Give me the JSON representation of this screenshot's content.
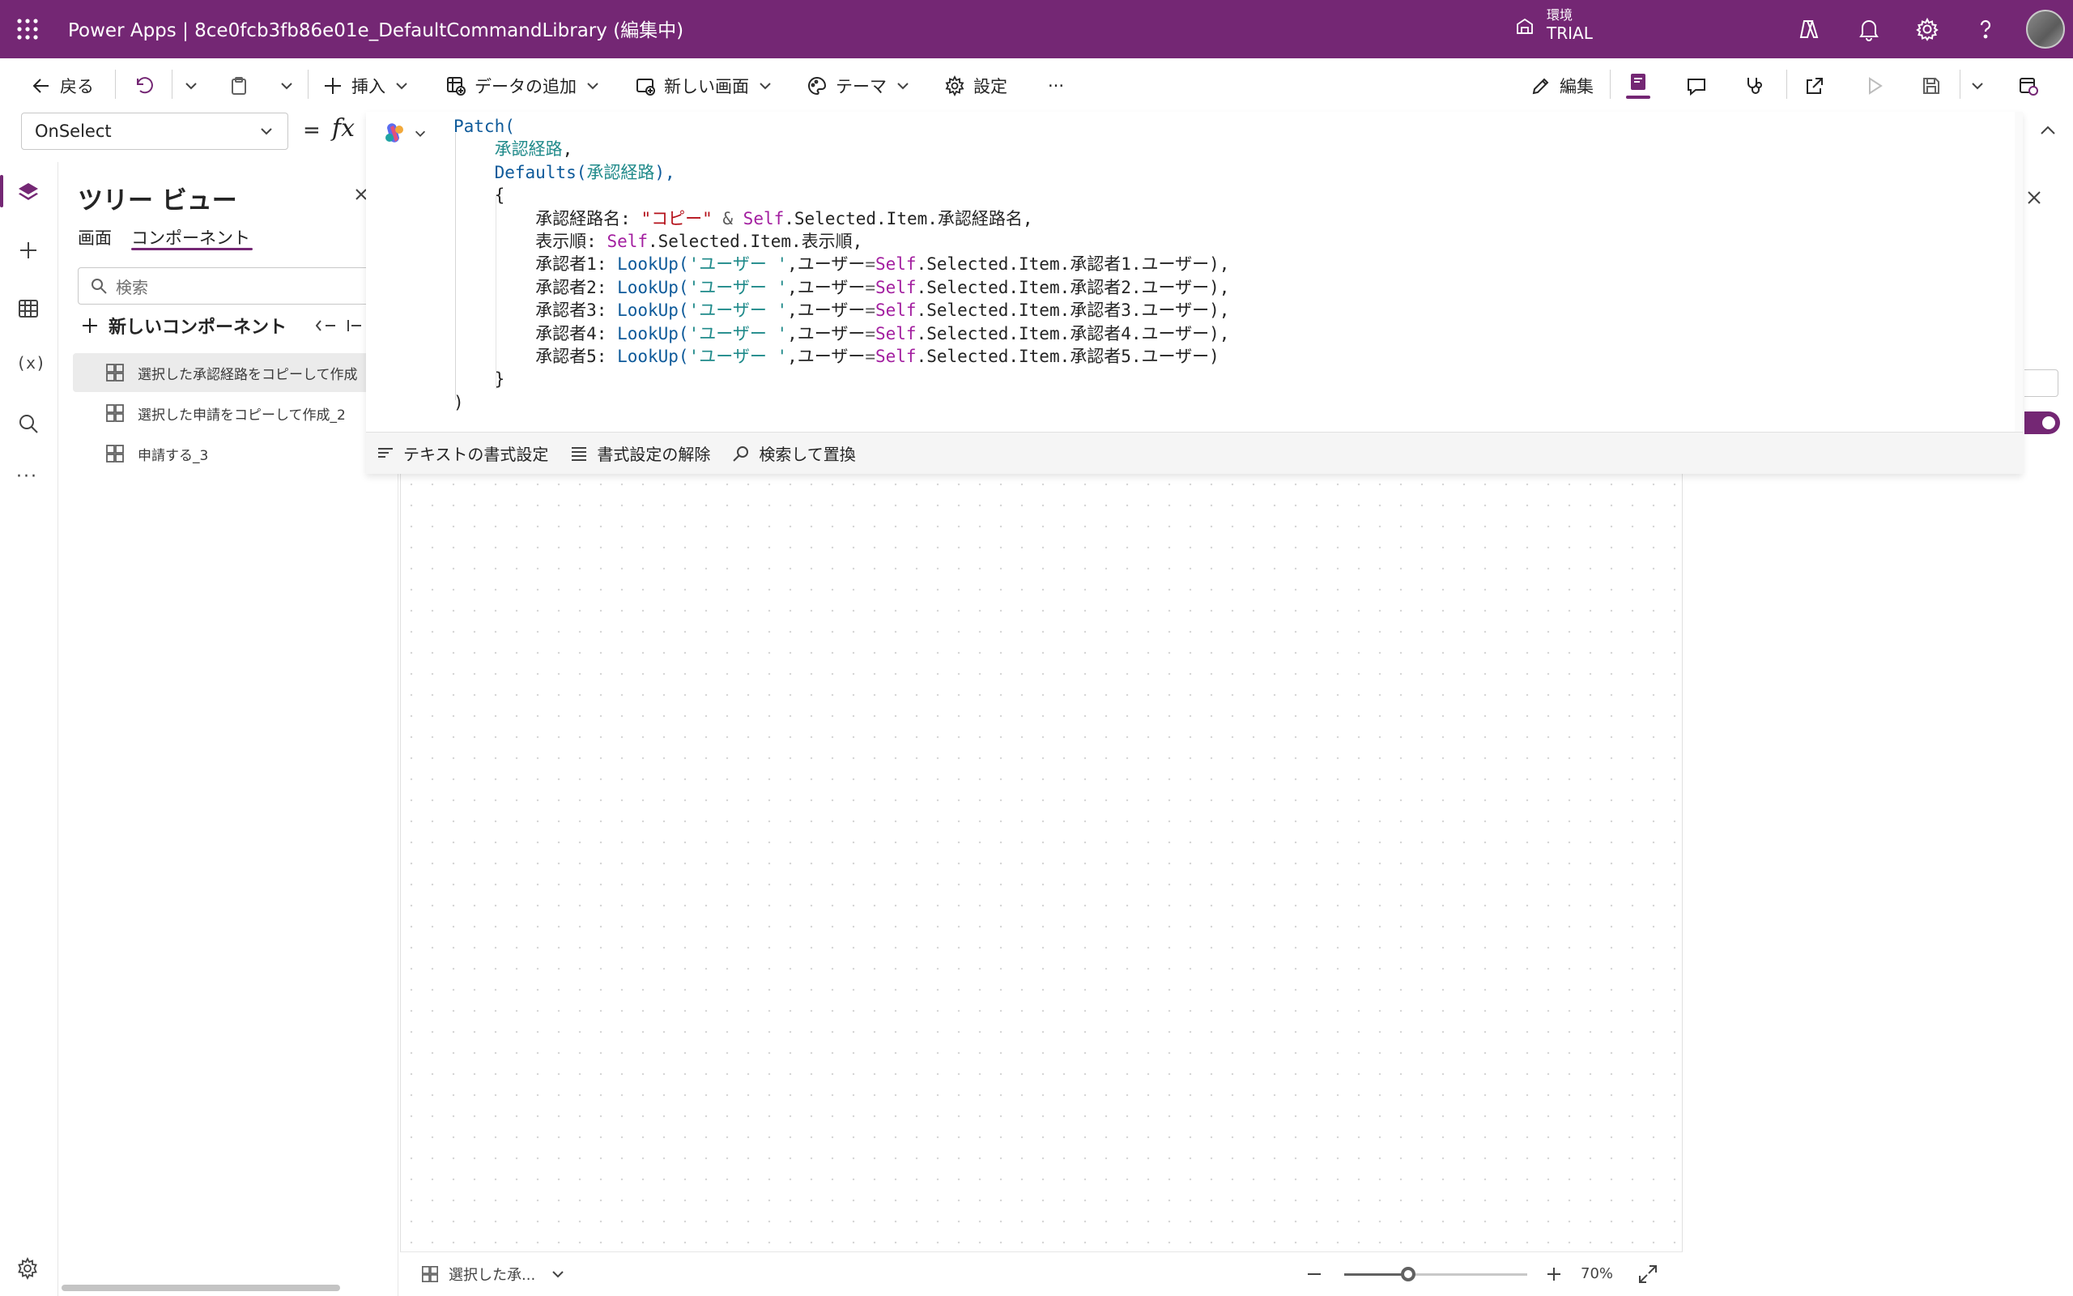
{
  "app": {
    "title": "Power Apps  |  8ce0fcb3fb86e01e_DefaultCommandLibrary (編集中)",
    "environment_label": "環境",
    "environment_value": "TRIAL"
  },
  "toolbar": {
    "back": "戻る",
    "insert": "挿入",
    "add_data": "データの追加",
    "new_screen": "新しい画面",
    "theme": "テーマ",
    "settings": "設定",
    "more": "···",
    "edit": "編集"
  },
  "formula_bar": {
    "property": "OnSelect",
    "equals": "=",
    "fx": "fx"
  },
  "formula": {
    "lines": [
      [
        {
          "t": "Patch(",
          "c": "pl"
        }
      ],
      [
        {
          "t": "    "
        },
        {
          "t": "承認経路",
          "c": "tl"
        },
        {
          "t": ","
        }
      ],
      [
        {
          "t": "    "
        },
        {
          "t": "Defaults(",
          "c": "pl"
        },
        {
          "t": "承認経路",
          "c": "tl"
        },
        {
          "t": "),",
          "c": "pl"
        }
      ],
      [
        {
          "t": "    {"
        }
      ],
      [
        {
          "t": "        承認経路名: "
        },
        {
          "t": "\"コピー\"",
          "c": "st"
        },
        {
          "t": " & ",
          "c": "op"
        },
        {
          "t": "Self",
          "c": "kw"
        },
        {
          "t": ".Selected.Item.承認経路名,"
        }
      ],
      [
        {
          "t": "        表示順: "
        },
        {
          "t": "Self",
          "c": "kw"
        },
        {
          "t": ".Selected.Item.表示順,"
        }
      ],
      [
        {
          "t": "        承認者1: "
        },
        {
          "t": "LookUp(",
          "c": "pl"
        },
        {
          "t": "'ユーザー '",
          "c": "tl"
        },
        {
          "t": ",ユーザー"
        },
        {
          "t": "=",
          "c": "op"
        },
        {
          "t": "Self",
          "c": "kw"
        },
        {
          "t": ".Selected.Item.承認者1.ユーザー),"
        }
      ],
      [
        {
          "t": "        承認者2: "
        },
        {
          "t": "LookUp(",
          "c": "pl"
        },
        {
          "t": "'ユーザー '",
          "c": "tl"
        },
        {
          "t": ",ユーザー"
        },
        {
          "t": "=",
          "c": "op"
        },
        {
          "t": "Self",
          "c": "kw"
        },
        {
          "t": ".Selected.Item.承認者2.ユーザー),"
        }
      ],
      [
        {
          "t": "        承認者3: "
        },
        {
          "t": "LookUp(",
          "c": "pl"
        },
        {
          "t": "'ユーザー '",
          "c": "tl"
        },
        {
          "t": ",ユーザー"
        },
        {
          "t": "=",
          "c": "op"
        },
        {
          "t": "Self",
          "c": "kw"
        },
        {
          "t": ".Selected.Item.承認者3.ユーザー),"
        }
      ],
      [
        {
          "t": "        承認者4: "
        },
        {
          "t": "LookUp(",
          "c": "pl"
        },
        {
          "t": "'ユーザー '",
          "c": "tl"
        },
        {
          "t": ",ユーザー"
        },
        {
          "t": "=",
          "c": "op"
        },
        {
          "t": "Self",
          "c": "kw"
        },
        {
          "t": ".Selected.Item.承認者4.ユーザー),"
        }
      ],
      [
        {
          "t": "        承認者5: "
        },
        {
          "t": "LookUp(",
          "c": "pl"
        },
        {
          "t": "'ユーザー '",
          "c": "tl"
        },
        {
          "t": ",ユーザー"
        },
        {
          "t": "=",
          "c": "op"
        },
        {
          "t": "Self",
          "c": "kw"
        },
        {
          "t": ".Selected.Item.承認者5.ユーザー)"
        }
      ],
      [
        {
          "t": "    }"
        }
      ],
      [
        {
          "t": ")"
        }
      ]
    ]
  },
  "editor_toolbar": {
    "format_text": "テキストの書式設定",
    "remove_format": "書式設定の解除",
    "find_replace": "検索して置換"
  },
  "tree": {
    "title": "ツリー ビュー",
    "tab_screens": "画面",
    "tab_components": "コンポーネント",
    "search_placeholder": "検索",
    "new_component": "新しいコンポーネント",
    "items": [
      "選択した承認経路をコピーして作成",
      "選択した申請をコピーして作成_2",
      "申請する_3"
    ]
  },
  "status": {
    "current": "選択した承...",
    "zoom": "70%",
    "zoom_level": 0.35
  },
  "colors": {
    "brand": "#742774",
    "string": "#b5121b",
    "keyword": "#a31fa0",
    "function": "#0e5a9a",
    "table": "#1f8a8a"
  }
}
